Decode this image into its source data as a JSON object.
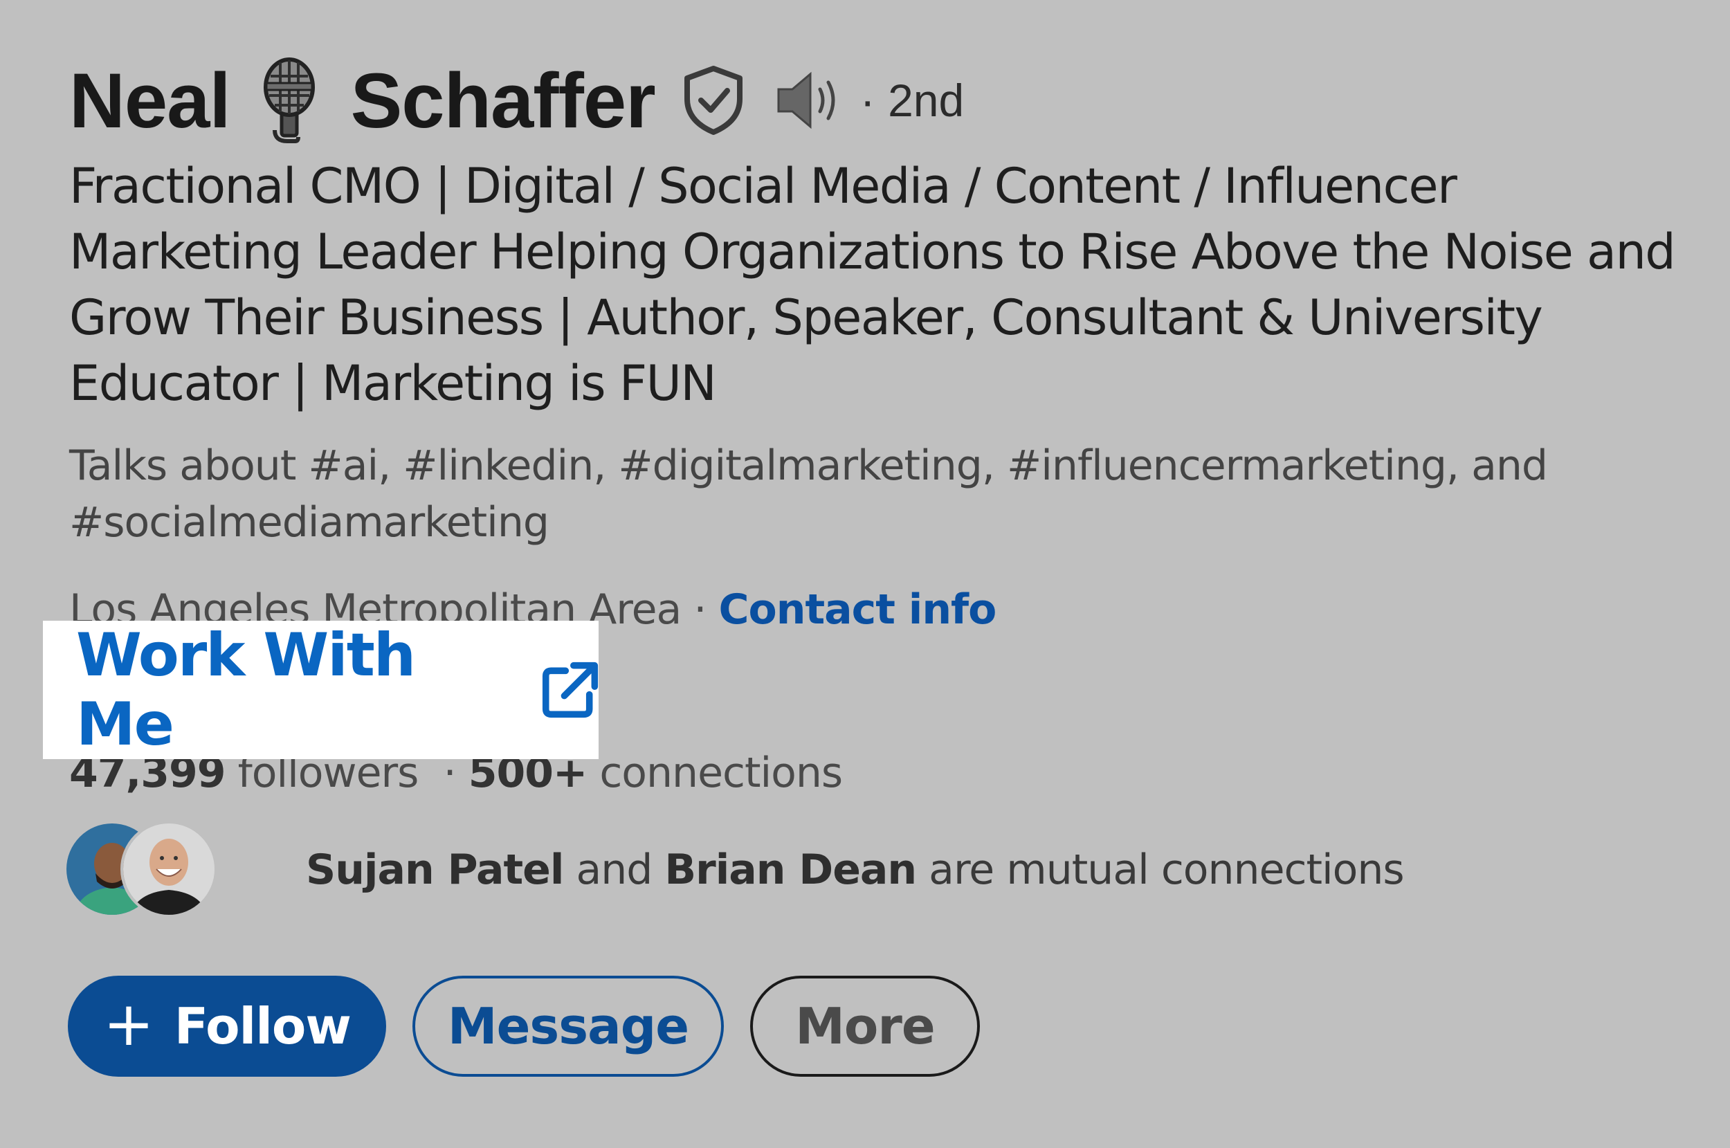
{
  "profile": {
    "first_name": "Neal",
    "last_name": "Schaffer",
    "degree": "· 2nd",
    "headline_lines": [
      "Fractional CMO | Digital / Social Media / Content / Influencer",
      "Marketing Leader Helping Organizations to Rise Above the Noise and",
      "Grow Their Business | Author, Speaker, Consultant & University",
      "Educator | Marketing is FUN"
    ],
    "talks_lines": [
      "Talks about #ai, #linkedin, #digitalmarketing, #influencermarketing, and",
      "#socialmediamarketing"
    ],
    "location": "Los Angeles Metropolitan Area",
    "location_sep": " · ",
    "contact_info": "Contact info",
    "website_link": "Work With Me",
    "followers_count": "47,399",
    "followers_label": " followers",
    "connections_sep": "  · ",
    "connections_count": "500+",
    "connections_label": " connections",
    "mutual_name_1": "Sujan Patel",
    "mutual_and": " and ",
    "mutual_name_2": "Brian Dean",
    "mutual_suffix": " are mutual connections"
  },
  "actions": {
    "follow_plus": "+",
    "follow_label": "Follow",
    "message_label": "Message",
    "more_label": "More"
  },
  "icons": {
    "name_emoji": "microphone-icon",
    "verified": "verified-shield-icon",
    "pronunciation": "speaker-icon",
    "external_link": "external-link-icon"
  },
  "colors": {
    "background": "#c0c0c0",
    "link_blue": "#0a66c2",
    "button_blue": "#0b4c93",
    "highlight": "#ffffff"
  }
}
